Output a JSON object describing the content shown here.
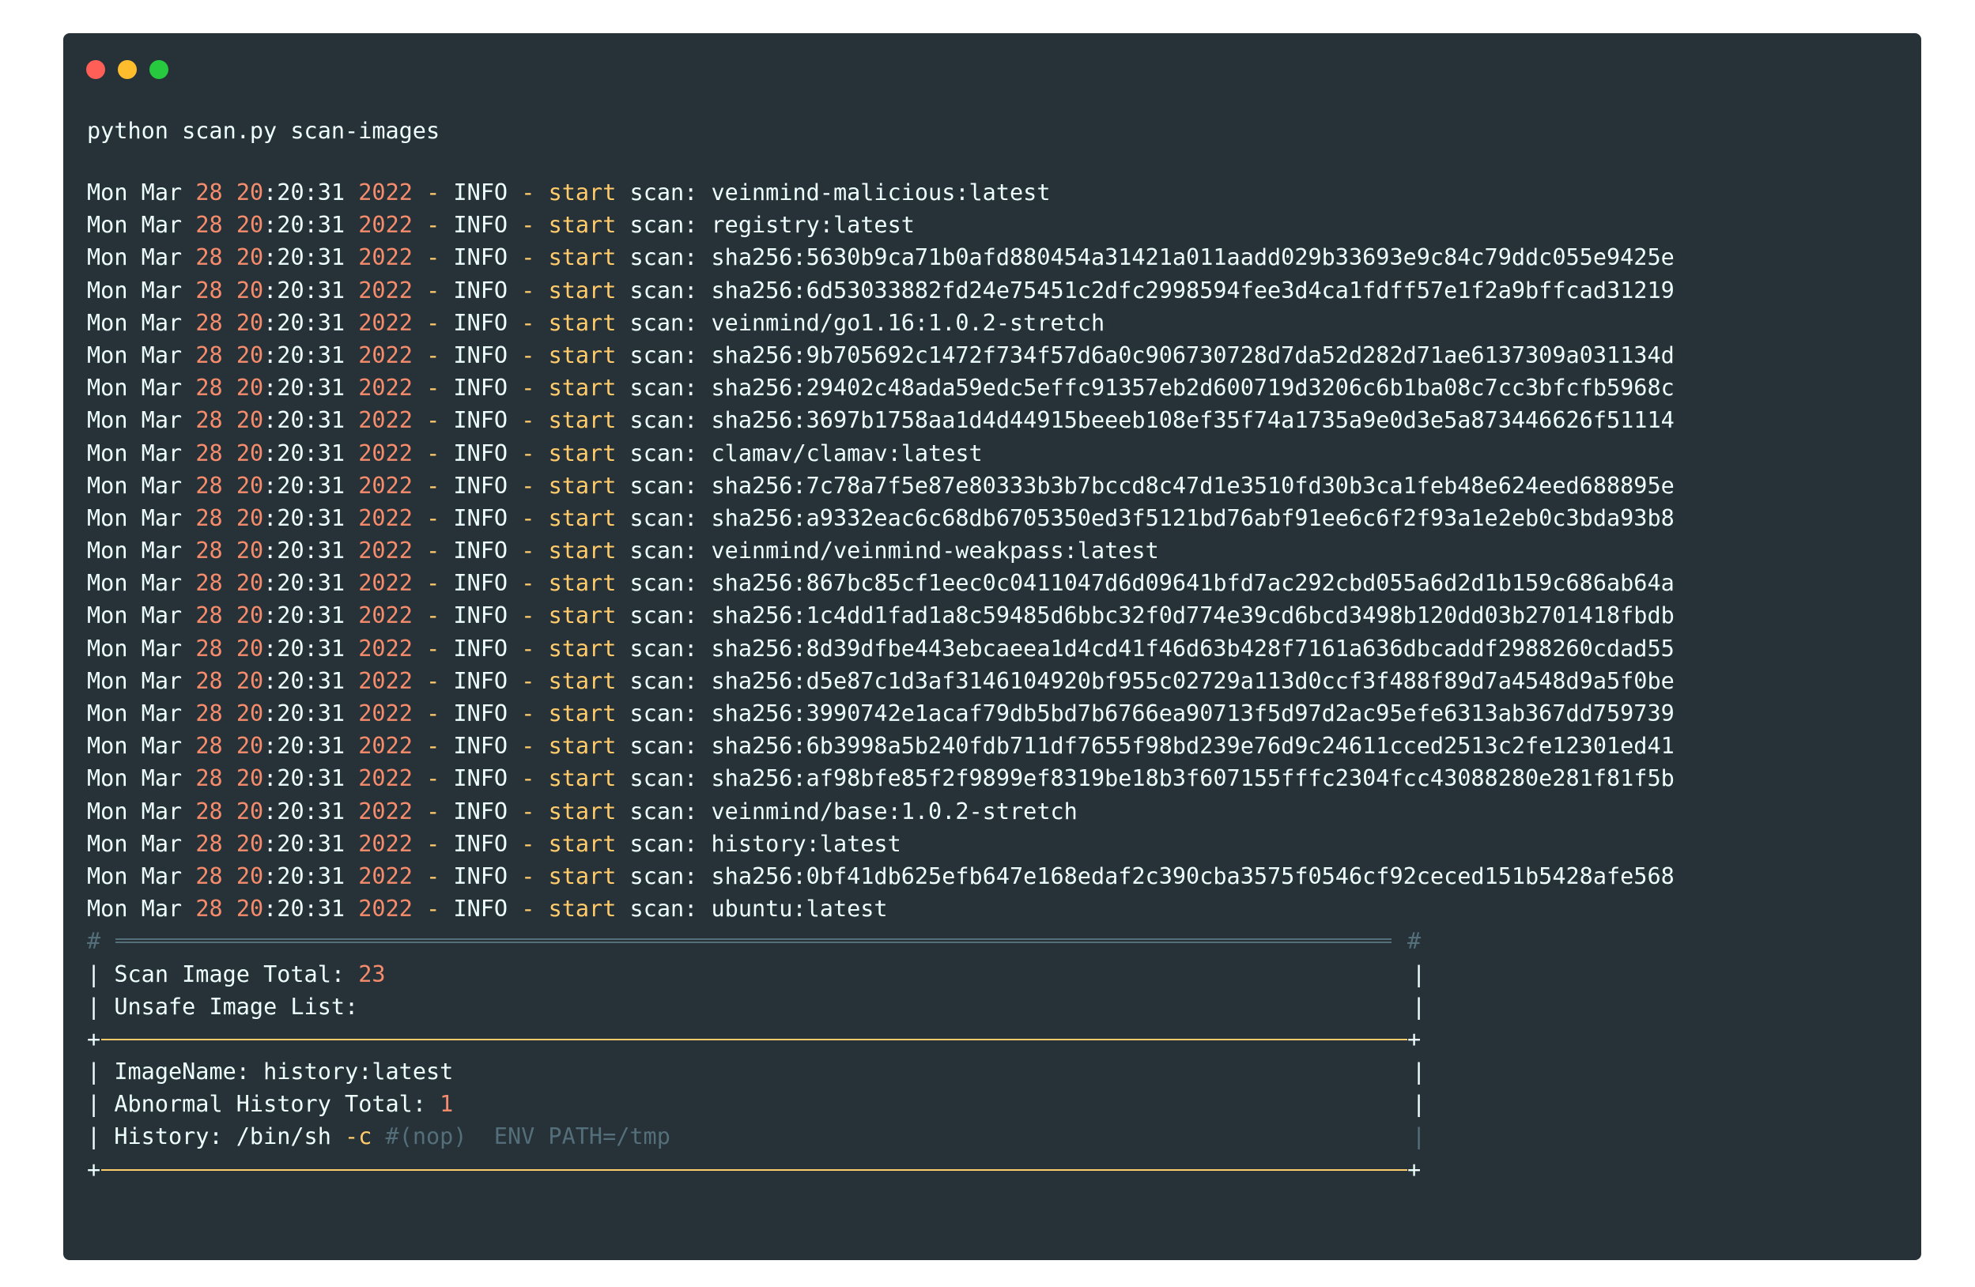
{
  "window": {
    "buttons": [
      "close",
      "minimize",
      "maximize"
    ],
    "colors": {
      "close": "#ff5f56",
      "minimize": "#ffbd2e",
      "maximize": "#27c93f"
    }
  },
  "command": "python scan.py scan-images",
  "log_prefix": {
    "day": "Mon",
    "month": "Mar",
    "date": "28",
    "hour": "20",
    "time_rest": ":20:31",
    "year": "2022",
    "sep1": "-",
    "level": "INFO",
    "sep2": "-",
    "action": "start",
    "label": "scan:"
  },
  "scan_targets": [
    "veinmind-malicious:latest",
    "registry:latest",
    "sha256:5630b9ca71b0afd880454a31421a011aadd029b33693e9c84c79ddc055e9425e",
    "sha256:6d53033882fd24e75451c2dfc2998594fee3d4ca1fdff57e1f2a9bffcad31219",
    "veinmind/go1.16:1.0.2-stretch",
    "sha256:9b705692c1472f734f57d6a0c906730728d7da52d282d71ae6137309a031134d",
    "sha256:29402c48ada59edc5effc91357eb2d600719d3206c6b1ba08c7cc3bfcfb5968c",
    "sha256:3697b1758aa1d4d44915beeeb108ef35f74a1735a9e0d3e5a873446626f51114",
    "clamav/clamav:latest",
    "sha256:7c78a7f5e87e80333b3b7bccd8c47d1e3510fd30b3ca1feb48e624eed688895e",
    "sha256:a9332eac6c68db6705350ed3f5121bd76abf91ee6c6f2f93a1e2eb0c3bda93b8",
    "veinmind/veinmind-weakpass:latest",
    "sha256:867bc85cf1eec0c0411047d6d09641bfd7ac292cbd055a6d2d1b159c686ab64a",
    "sha256:1c4dd1fad1a8c59485d6bbc32f0d774e39cd6bcd3498b120dd03b2701418fbdb",
    "sha256:8d39dfbe443ebcaeea1d4cd41f46d63b428f7161a636dbcaddf2988260cdad55",
    "sha256:d5e87c1d3af3146104920bf955c02729a113d0ccf3f488f89d7a4548d9a5f0be",
    "sha256:3990742e1acaf79db5bd7b6766ea90713f5d97d2ac95efe6313ab367dd759739",
    "sha256:6b3998a5b240fdb711df7655f98bd239e76d9c24611cced2513c2fe12301ed41",
    "sha256:af98bfe85f2f9899ef8319be18b3f607155fffc2304fcc43088280e281f81f5b",
    "veinmind/base:1.0.2-stretch",
    "history:latest",
    "sha256:0bf41db625efb647e168edaf2c390cba3575f0546cf92ceced151b5428afe568",
    "ubuntu:latest"
  ],
  "report": {
    "corner_hash": "#",
    "corner_plus": "+",
    "bar": "|",
    "total_label": "Scan Image Total: ",
    "total_value": "23",
    "unsafe_label": "Unsafe Image List:",
    "image_name_label": "ImageName: ",
    "image_name_value": "history:latest",
    "abnormal_label": "Abnormal History Total: ",
    "abnormal_value": "1",
    "history_label": "History: /bin/sh ",
    "history_flag": "-c",
    "history_comment": " #(nop)  ENV PATH=/tmp"
  }
}
